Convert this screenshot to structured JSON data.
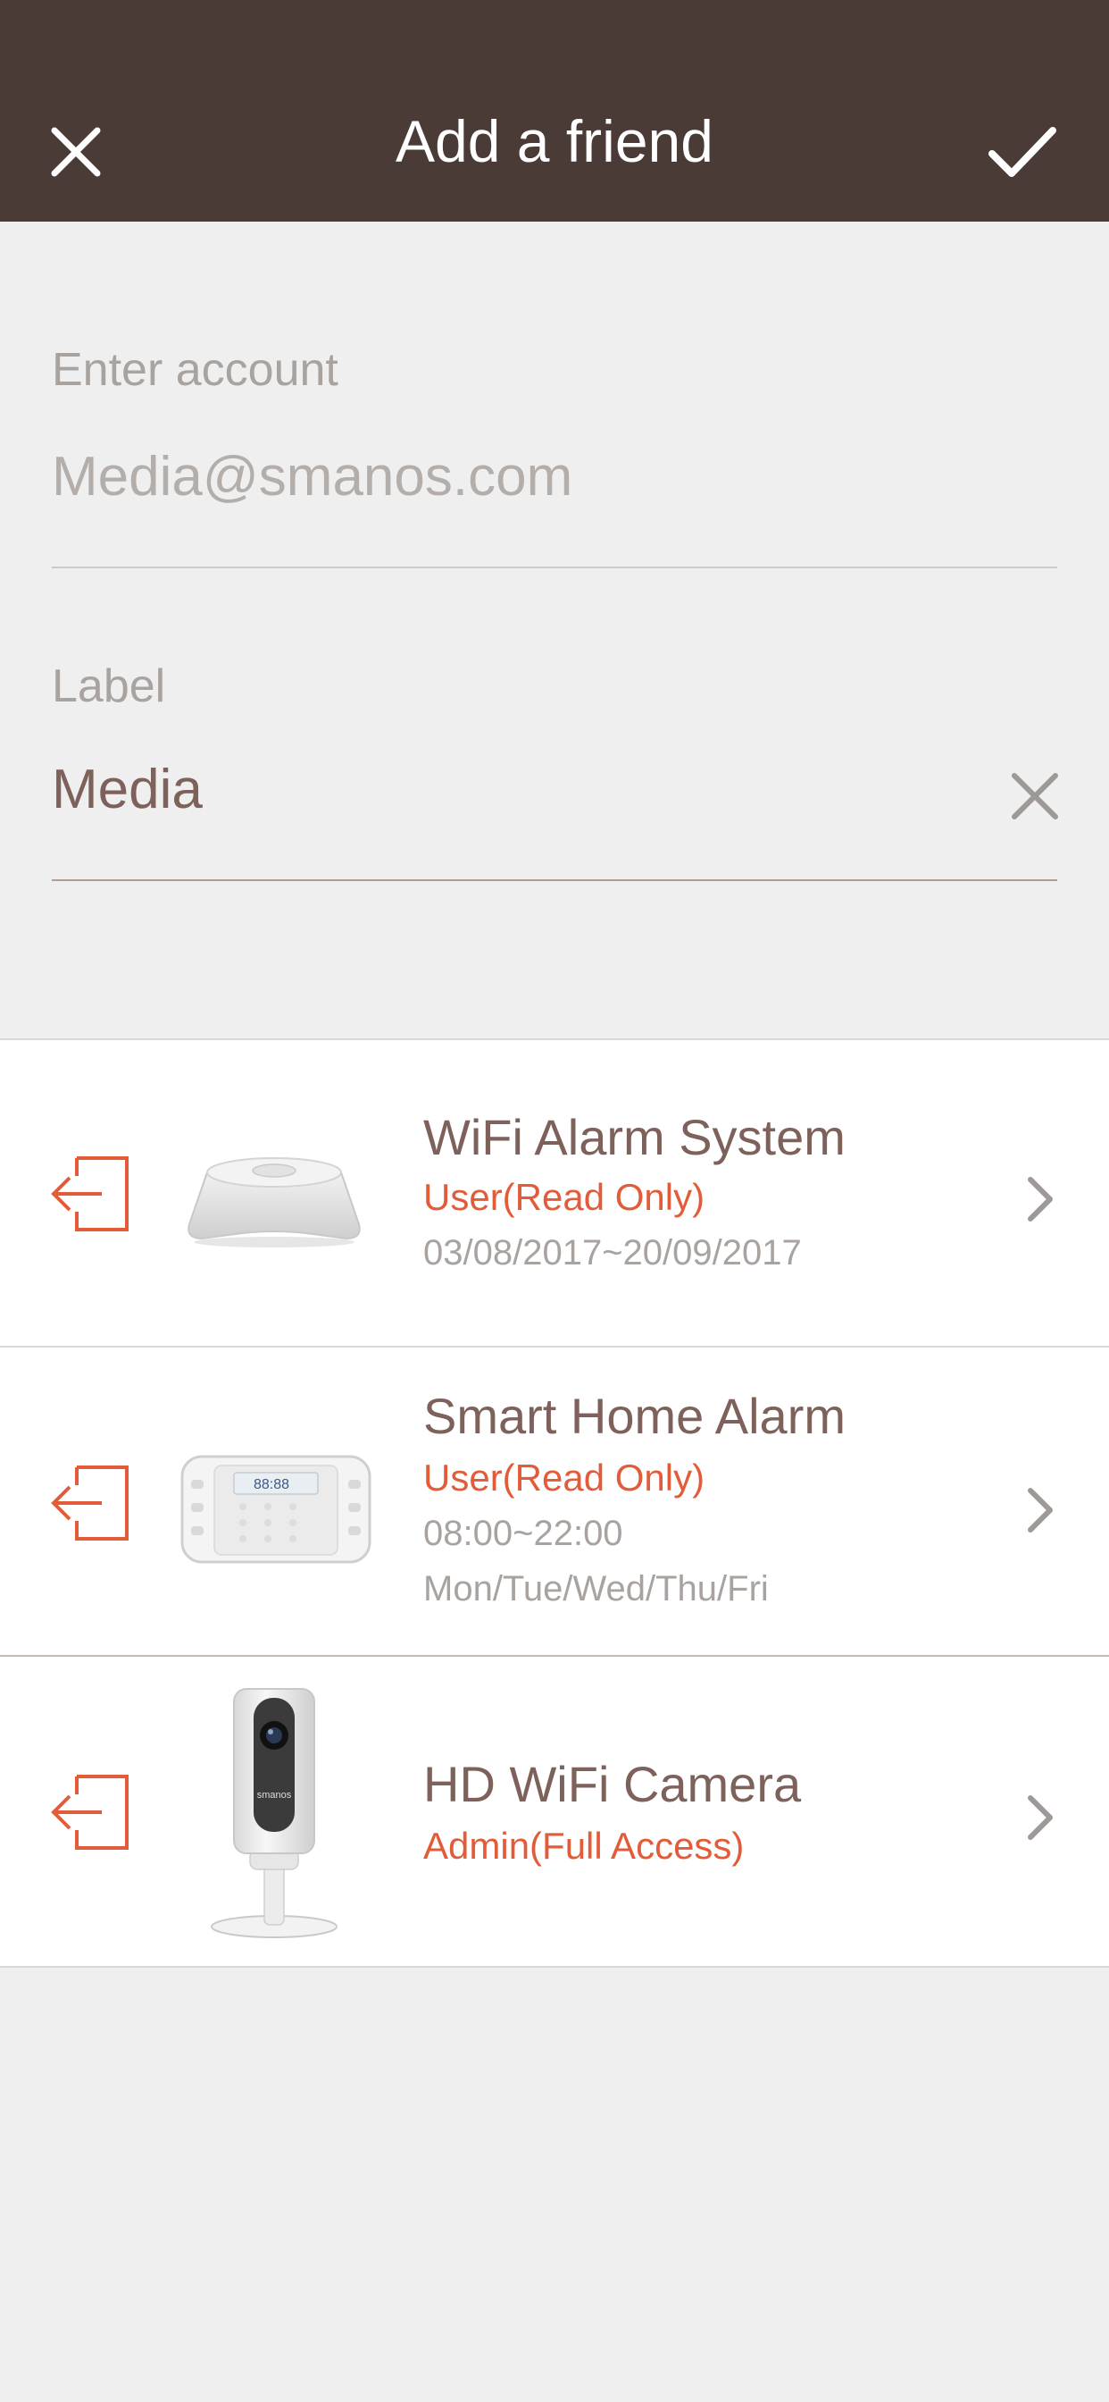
{
  "header": {
    "title": "Add a friend",
    "close_icon": "close-icon",
    "confirm_icon": "checkmark-icon"
  },
  "form": {
    "account": {
      "label": "Enter account",
      "value": "Media@smanos.com"
    },
    "label_field": {
      "label": "Label",
      "value": "Media",
      "clear_icon": "clear-icon"
    }
  },
  "devices": [
    {
      "name": "WiFi Alarm System",
      "role": "User(Read Only)",
      "meta": [
        "03/08/2017~20/09/2017"
      ],
      "image": "wifi-hub-image"
    },
    {
      "name": "Smart Home Alarm",
      "role": "User(Read Only)",
      "meta": [
        "08:00~22:00",
        "Mon/Tue/Wed/Thu/Fri"
      ],
      "image": "alarm-panel-image",
      "panel_display": "88:88"
    },
    {
      "name": "HD WiFi Camera",
      "role": "Admin(Full Access)",
      "meta": [],
      "image": "camera-image",
      "brand": "smanos"
    }
  ],
  "colors": {
    "header_bg": "#4a3b37",
    "accent": "#e25c3a",
    "text_brown": "#7d615a",
    "text_muted": "#a9a3a0",
    "background": "#efefef"
  }
}
